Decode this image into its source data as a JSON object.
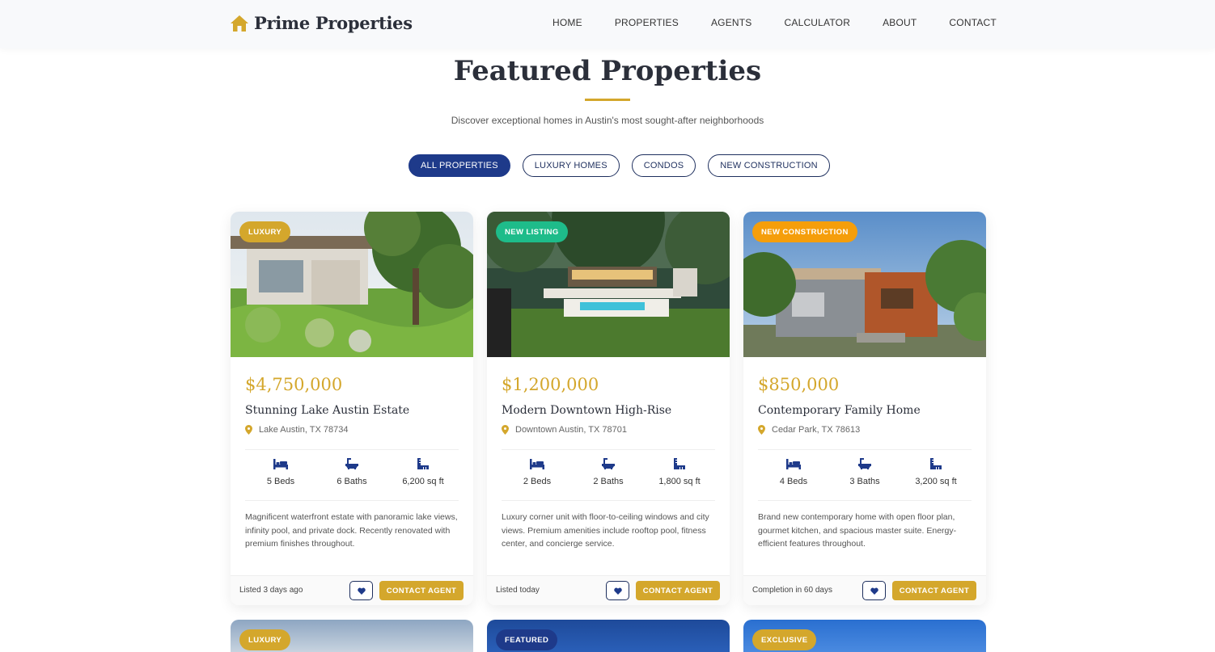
{
  "brand": {
    "name": "Prime Properties",
    "icon": "house-icon",
    "color": "#d4a72c"
  },
  "nav": [
    "HOME",
    "PROPERTIES",
    "AGENTS",
    "CALCULATOR",
    "ABOUT",
    "CONTACT"
  ],
  "section": {
    "title": "Featured Properties",
    "subtitle": "Discover exceptional homes in Austin's most sought-after neighborhoods"
  },
  "filters": [
    {
      "label": "ALL PROPERTIES",
      "active": true
    },
    {
      "label": "LUXURY HOMES",
      "active": false
    },
    {
      "label": "CONDOS",
      "active": false
    },
    {
      "label": "NEW CONSTRUCTION",
      "active": false
    }
  ],
  "colors": {
    "navy": "#1e3a8a",
    "gold": "#d4a72c",
    "green": "#1ebc8a",
    "orange": "#f59e0b"
  },
  "properties": [
    {
      "badge": "LUXURY",
      "badge_color": "#d4a72c",
      "price": "$4,750,000",
      "name": "Stunning Lake Austin Estate",
      "location": "Lake Austin, TX 78734",
      "beds": "5 Beds",
      "baths": "6 Baths",
      "sqft": "6,200 sq ft",
      "description": "Magnificent waterfront estate with panoramic lake views, infinity pool, and private dock. Recently renovated with premium finishes throughout.",
      "listed": "Listed 3 days ago",
      "cta": "CONTACT AGENT"
    },
    {
      "badge": "NEW LISTING",
      "badge_color": "#1ebc8a",
      "price": "$1,200,000",
      "name": "Modern Downtown High-Rise",
      "location": "Downtown Austin, TX 78701",
      "beds": "2 Beds",
      "baths": "2 Baths",
      "sqft": "1,800 sq ft",
      "description": "Luxury corner unit with floor-to-ceiling windows and city views. Premium amenities include rooftop pool, fitness center, and concierge service.",
      "listed": "Listed today",
      "cta": "CONTACT AGENT"
    },
    {
      "badge": "NEW CONSTRUCTION",
      "badge_color": "#f59e0b",
      "price": "$850,000",
      "name": "Contemporary Family Home",
      "location": "Cedar Park, TX 78613",
      "beds": "4 Beds",
      "baths": "3 Baths",
      "sqft": "3,200 sq ft",
      "description": "Brand new contemporary home with open floor plan, gourmet kitchen, and spacious master suite. Energy-efficient features throughout.",
      "listed": "Completion in 60 days",
      "cta": "CONTACT AGENT"
    }
  ],
  "next_row_badges": [
    "LUXURY",
    "FEATURED",
    "EXCLUSIVE"
  ]
}
